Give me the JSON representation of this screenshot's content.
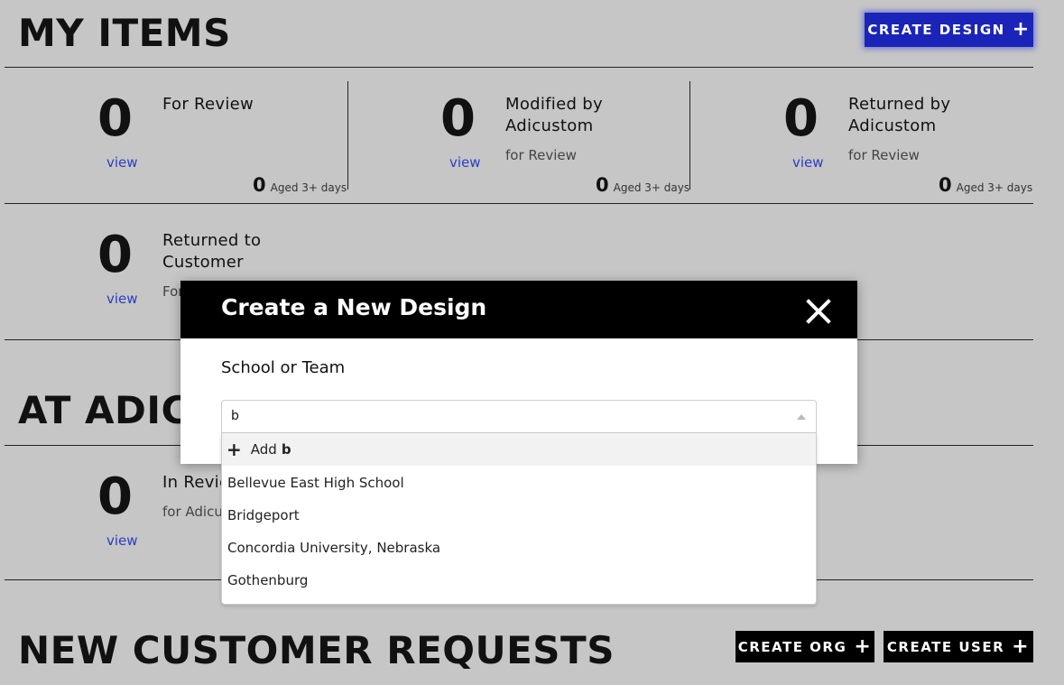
{
  "my_items": {
    "title": "MY ITEMS",
    "create_design_label": "CREATE DESIGN",
    "cards": [
      {
        "count": "0",
        "view": "view",
        "title_line1": "For Review",
        "title_line2": "",
        "sub": "",
        "aged_count": "0",
        "aged_text": "Aged 3+ days"
      },
      {
        "count": "0",
        "view": "view",
        "title_line1": "Modified by",
        "title_line2": "Adicustom",
        "sub": "for Review",
        "aged_count": "0",
        "aged_text": "Aged 3+ days"
      },
      {
        "count": "0",
        "view": "view",
        "title_line1": "Returned by",
        "title_line2": "Adicustom",
        "sub": "for Review",
        "aged_count": "0",
        "aged_text": "Aged 3+ days"
      },
      {
        "count": "0",
        "view": "view",
        "title_line1": "Returned to",
        "title_line2": "Customer",
        "sub": "For"
      }
    ]
  },
  "at_adicustom": {
    "title": "AT ADICU",
    "cards": [
      {
        "count": "0",
        "view": "view",
        "title": "In Revie",
        "sub": "for Adicus"
      }
    ]
  },
  "new_customer_requests": {
    "title": "NEW CUSTOMER REQUESTS",
    "create_org_label": "CREATE ORG",
    "create_user_label": "CREATE USER"
  },
  "modal": {
    "title": "Create a New Design",
    "field_label": "School or Team",
    "input_value": "b",
    "add_prefix": "Add",
    "add_term": "b",
    "options": [
      "Bellevue East High School",
      "Bridgeport",
      "Concordia University, Nebraska",
      "Gothenburg"
    ]
  },
  "colors": {
    "background": "#c6c6c6",
    "accent_blue": "#1b24b8",
    "link_blue": "#2a3dc5",
    "modal_header": "#000000"
  }
}
